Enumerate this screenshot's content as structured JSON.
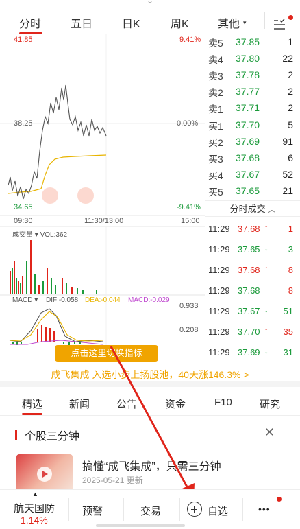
{
  "tabs": [
    {
      "label": "分时"
    },
    {
      "label": "五日"
    },
    {
      "label": "日K"
    },
    {
      "label": "周K"
    },
    {
      "label": "其他"
    }
  ],
  "chart": {
    "price_high": "41.85",
    "price_mid": "38.25",
    "price_low": "34.65",
    "pct_high": "9.41%",
    "pct_mid": "0.00%",
    "pct_low": "-9.41%",
    "time_start": "09:30",
    "time_mid": "11:30/13:00",
    "time_end": "15:00",
    "volume_label": "成交量",
    "volume_value": "VOL:362",
    "macd_label": "MACD",
    "dif_value": "DIF:-0.058",
    "dea_value": "DEA:-0.044",
    "macd_value": "MACD:-0.029",
    "macd_axis_top": "0.933",
    "macd_axis_bottom": "0.208"
  },
  "order_book": [
    {
      "label": "卖5",
      "price": "37.85",
      "vol": "1"
    },
    {
      "label": "卖4",
      "price": "37.80",
      "vol": "22"
    },
    {
      "label": "卖3",
      "price": "37.78",
      "vol": "2"
    },
    {
      "label": "卖2",
      "price": "37.77",
      "vol": "2"
    },
    {
      "label": "卖1",
      "price": "37.71",
      "vol": "2"
    },
    {
      "label": "买1",
      "price": "37.70",
      "vol": "5"
    },
    {
      "label": "买2",
      "price": "37.69",
      "vol": "91"
    },
    {
      "label": "买3",
      "price": "37.68",
      "vol": "6"
    },
    {
      "label": "买4",
      "price": "37.67",
      "vol": "52"
    },
    {
      "label": "买5",
      "price": "37.65",
      "vol": "21"
    }
  ],
  "trades_header": "分时成交",
  "trades": [
    {
      "time": "11:29",
      "price": "37.68",
      "arrow": "↑",
      "vol": "1",
      "color": "red"
    },
    {
      "time": "11:29",
      "price": "37.65",
      "arrow": "↓",
      "vol": "3",
      "color": "green"
    },
    {
      "time": "11:29",
      "price": "37.68",
      "arrow": "↑",
      "vol": "8",
      "color": "red"
    },
    {
      "time": "11:29",
      "price": "37.68",
      "arrow": "",
      "vol": "8",
      "color": "green"
    },
    {
      "time": "11:29",
      "price": "37.67",
      "arrow": "↓",
      "vol": "51",
      "color": "green"
    },
    {
      "time": "11:29",
      "price": "37.70",
      "arrow": "↑",
      "vol": "35",
      "color": "red"
    },
    {
      "time": "11:29",
      "price": "37.69",
      "arrow": "↓",
      "vol": "31",
      "color": "green"
    }
  ],
  "tooltip": "点击这里切换指标",
  "banner": "成飞集成 入选小步上扬股池，40天涨146.3% >",
  "info_tabs": [
    {
      "label": "精选"
    },
    {
      "label": "新闻"
    },
    {
      "label": "公告"
    },
    {
      "label": "资金"
    },
    {
      "label": "F10"
    },
    {
      "label": "研究"
    }
  ],
  "section": {
    "title": "个股三分钟"
  },
  "article": {
    "title": "搞懂“成飞集成”，只需三分钟",
    "date": "2025-05-21 更新"
  },
  "bottom_bar": {
    "stock_name": "航天国防",
    "stock_pct": "1.14%",
    "alert": "预警",
    "trade": "交易",
    "watchlist": "自选",
    "more": "•••"
  },
  "colors": {
    "up": "#e0251b",
    "down": "#1a9a3a",
    "avg_line": "#e8b400",
    "accent": "#f0a400"
  }
}
